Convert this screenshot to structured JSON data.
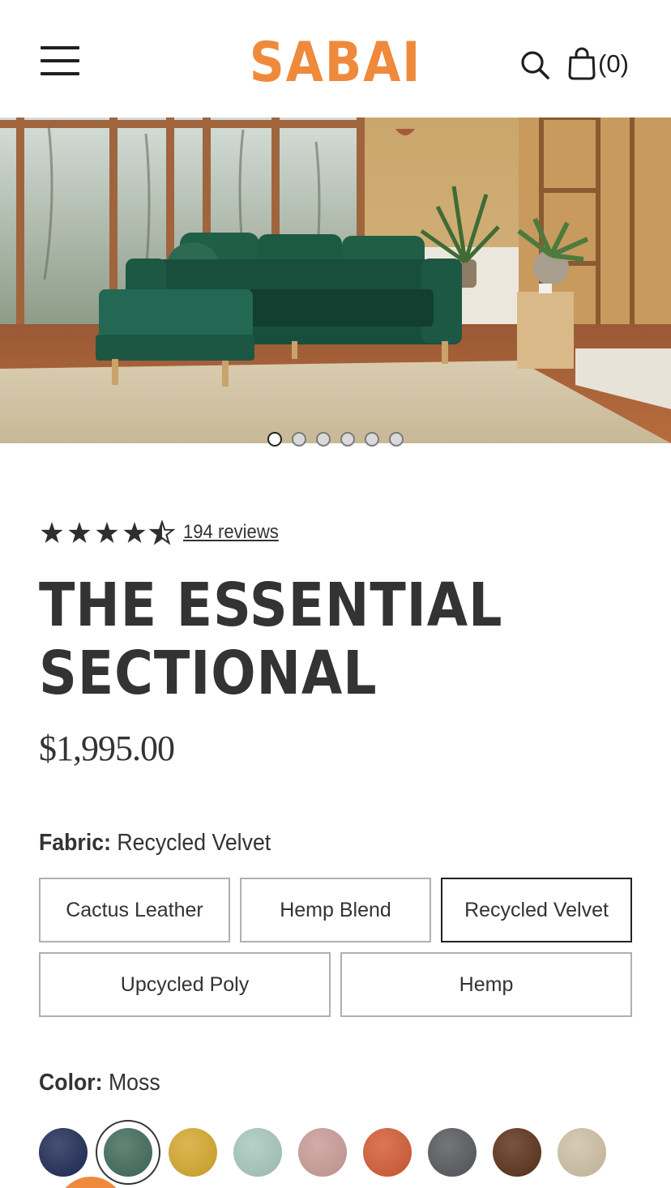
{
  "brand": {
    "name": "SABAI",
    "color": "#EF8A3C"
  },
  "header": {
    "menu_icon": "hamburger-menu-icon",
    "search_icon": "search-icon",
    "cart_icon": "shopping-bag-icon",
    "cart_count": "(0)"
  },
  "gallery": {
    "image": "green velvet sectional sofa in sunlit living room",
    "total_slides": 6,
    "active_slide": 1
  },
  "rating": {
    "stars": 4.5,
    "reviews_label": "194 reviews"
  },
  "product": {
    "title_line1": "THE ESSENTIAL",
    "title_line2": "SECTIONAL",
    "price": "$1,995.00"
  },
  "fabric": {
    "label": "Fabric:",
    "selected": "Recycled Velvet",
    "options": [
      "Cactus Leather",
      "Hemp Blend",
      "Recycled Velvet",
      "Upcycled Poly",
      "Hemp"
    ]
  },
  "color": {
    "label": "Color:",
    "selected": "Moss",
    "swatches": [
      {
        "color": "#1E2A55"
      },
      {
        "color": "#3F6A58"
      },
      {
        "color": "#D4A72C"
      },
      {
        "color": "#A6C7BC"
      },
      {
        "color": "#C99B96"
      },
      {
        "color": "#D25A33"
      },
      {
        "color": "#55585C"
      },
      {
        "color": "#5A3018"
      },
      {
        "color": "#CDBFA4"
      }
    ]
  },
  "chat_bubble_color": "#EF8A3C"
}
